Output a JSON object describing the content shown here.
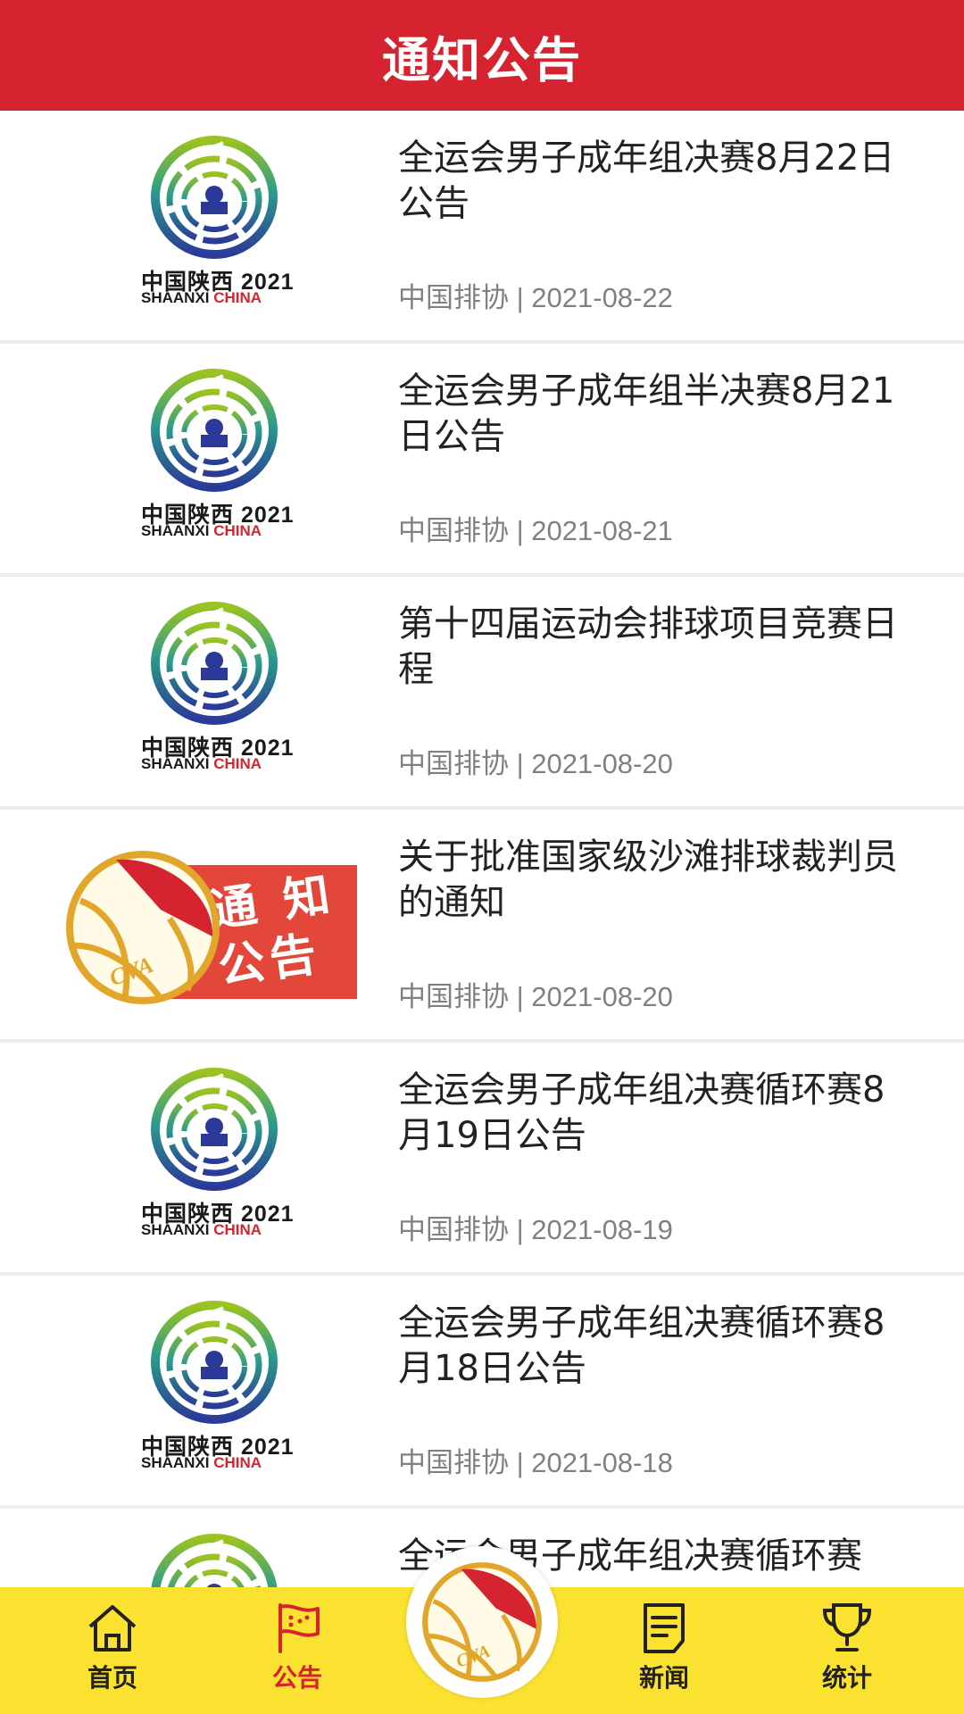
{
  "header": {
    "title": "通知公告"
  },
  "notices": [
    {
      "title": "全运会男子成年组决赛8月22日公告",
      "meta": "中国排协 | 2021-08-22",
      "thumb": "shaanxi"
    },
    {
      "title": "全运会男子成年组半决赛8月21日公告",
      "meta": "中国排协 | 2021-08-21",
      "thumb": "shaanxi"
    },
    {
      "title": "第十四届运动会排球项目竞赛日程",
      "meta": "中国排协 | 2021-08-20",
      "thumb": "shaanxi"
    },
    {
      "title": "关于批准国家级沙滩排球裁判员的通知",
      "meta": "中国排协 | 2021-08-20",
      "thumb": "cva"
    },
    {
      "title": "全运会男子成年组决赛循环赛8月19日公告",
      "meta": "中国排协 | 2021-08-19",
      "thumb": "shaanxi"
    },
    {
      "title": "全运会男子成年组决赛循环赛8月18日公告",
      "meta": "中国排协 | 2021-08-18",
      "thumb": "shaanxi"
    },
    {
      "title": "全运会男子成年组决赛循环赛",
      "meta": "",
      "thumb": "shaanxi"
    }
  ],
  "logo_sx": {
    "line1": "中国陕西 2021",
    "line2a": "SHAANXI ",
    "line2b": "CHINA"
  },
  "logo_cva": {
    "text": "通 知\n公告",
    "ball_label": "CVA"
  },
  "nav": {
    "items": [
      {
        "label": "首页",
        "icon": "home-icon"
      },
      {
        "label": "公告",
        "icon": "flag-icon",
        "active": true
      },
      {
        "label": "新闻",
        "icon": "news-icon"
      },
      {
        "label": "统计",
        "icon": "trophy-icon"
      }
    ]
  },
  "colors": {
    "header_red": "#d52330",
    "nav_yellow": "#fce230",
    "meta_gray": "#808080"
  }
}
